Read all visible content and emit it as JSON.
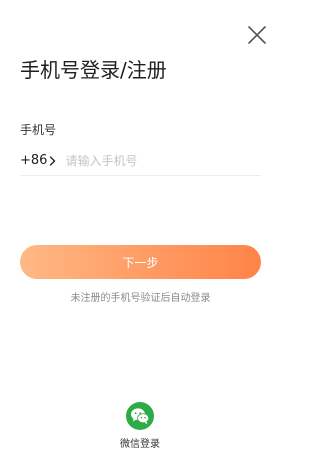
{
  "header": {
    "close_icon": "close-icon",
    "title": "手机号登录/注册"
  },
  "phone": {
    "label": "手机号",
    "country_code": "+86",
    "country_code_icon": "chevron-right-icon",
    "placeholder": "请输入手机号",
    "value": ""
  },
  "actions": {
    "next_label": "下一步",
    "hint": "未注册的手机号验证后自动登录"
  },
  "social": {
    "wechat_icon": "wechat-icon",
    "wechat_label": "微信登录"
  },
  "colors": {
    "accent_start": "#ffb985",
    "accent_end": "#ff8447",
    "wechat_green": "#2eaa47"
  }
}
